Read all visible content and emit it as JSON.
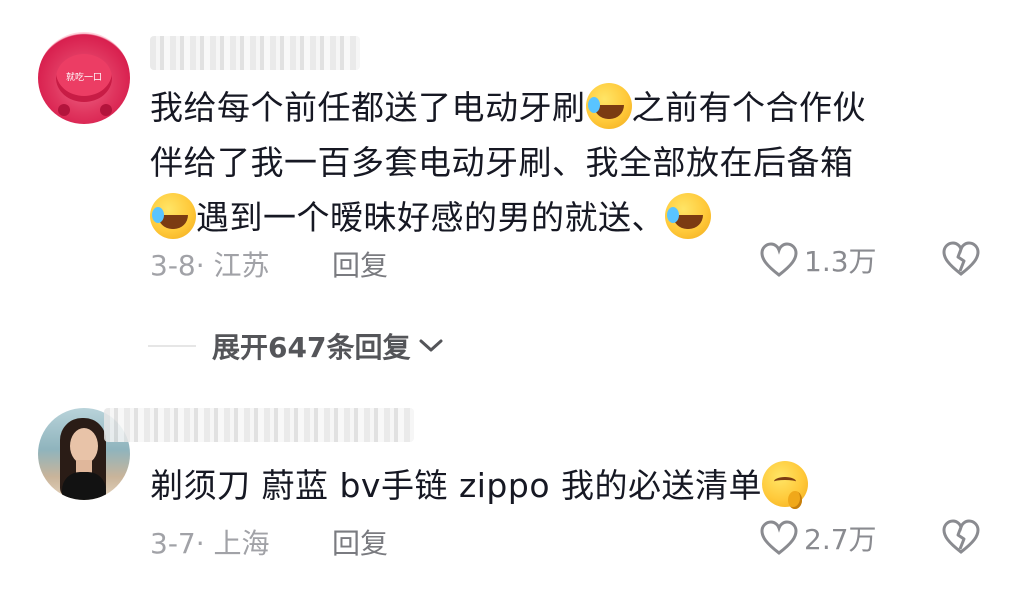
{
  "comments": [
    {
      "avatar_text": "就吃一口",
      "text_segments": [
        {
          "line": "我给每个前任都送了电动牙刷",
          "emoji_after": "laugh-cry-emoji"
        },
        {
          "line": "之前有个合作伙"
        },
        {
          "line": "伴给了我一百多套电动牙刷、我全部放在后备箱"
        },
        {
          "line": "遇到一个暧昧好感的男的就送、",
          "emoji_before": "laugh-cry-emoji",
          "emoji_after": "laugh-cry-emoji"
        }
      ],
      "date_location": "3-8· 江苏",
      "reply_label": "回复",
      "likes": "1.3万"
    },
    {
      "text": "剃须刀 蔚蓝 bv手链 zippo 我的必送清单",
      "emoji_after": "drooling-emoji",
      "date_location": "3-7· 上海",
      "reply_label": "回复",
      "likes": "2.7万"
    }
  ],
  "expand_replies": {
    "label": "展开647条回复",
    "icon": "chevron-down-icon"
  },
  "colors": {
    "text": "#161823",
    "meta": "#a1a2a7",
    "icon": "#8a8b90",
    "expand": "#545559"
  }
}
